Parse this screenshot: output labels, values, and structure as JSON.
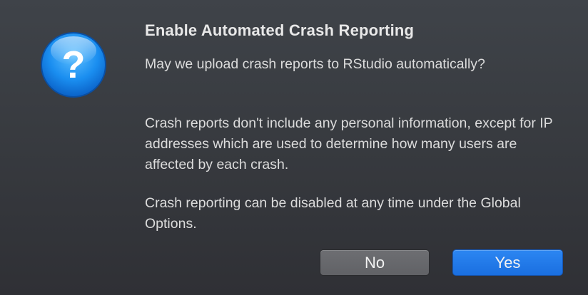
{
  "dialog": {
    "icon": "question-mark-icon",
    "title": "Enable Automated Crash Reporting",
    "paragraphs": [
      "May we upload crash reports to RStudio automatically?",
      "Crash reports don't include any personal information, except for IP addresses which are used to determine how many users are affected by each crash.",
      "Crash reporting can be disabled at any time under the Global Options."
    ],
    "buttons": {
      "no_label": "No",
      "yes_label": "Yes"
    },
    "colors": {
      "accent": "#1a6fe0",
      "icon_blue": "#1e90f0"
    }
  }
}
